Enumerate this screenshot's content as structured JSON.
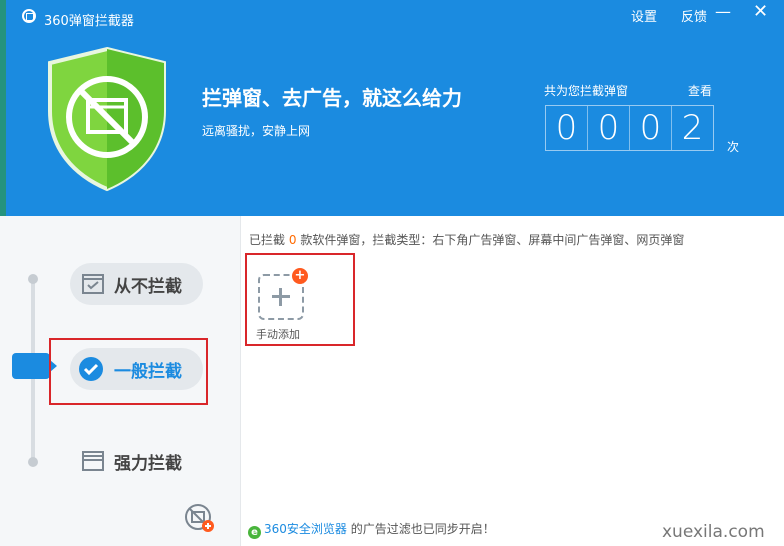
{
  "titlebar": {
    "app_title": "360弹窗拦截器",
    "settings": "设置",
    "feedback": "反馈",
    "minimize": "—",
    "close": "✕"
  },
  "hero": {
    "slogan": "拦弹窗、去广告，就这么给力",
    "subslogan": "远离骚扰，安静上网",
    "count_label": "共为您拦截弹窗",
    "view_link": "查看",
    "digits": [
      "0",
      "0",
      "0",
      "2"
    ],
    "unit": "次"
  },
  "modes": {
    "never": "从不拦截",
    "normal": "一般拦截",
    "strong": "强力拦截",
    "selected": "一般拦截"
  },
  "main": {
    "info_prefix": "已拦截",
    "info_count": "0",
    "info_suffix": "款软件弹窗，拦截类型：右下角广告弹窗、屏幕中间广告弹窗、网页弹窗",
    "add_label": "手动添加",
    "add_badge": "+"
  },
  "footer": {
    "browser_link": "360安全浏览器",
    "note": "的广告过滤也已同步开启！"
  },
  "watermark": "xuexila.com",
  "colors": {
    "header": "#1b8be0",
    "shield": "#5cc431",
    "highlight_box": "#d9262a",
    "count_accent": "#ff6a00"
  }
}
